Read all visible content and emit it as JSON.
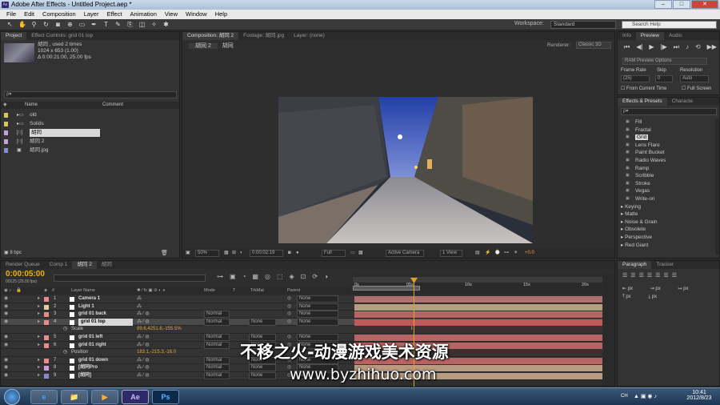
{
  "window": {
    "title": "Adobe After Effects - Untitled Project.aep *",
    "app_icon": "Ae",
    "min": "–",
    "max": "□",
    "close": "✕"
  },
  "menu": [
    "File",
    "Edit",
    "Composition",
    "Layer",
    "Effect",
    "Animation",
    "View",
    "Window",
    "Help"
  ],
  "toolbar": {
    "workspace_label": "Workspace:",
    "workspace_value": "Standard",
    "search_placeholder": "Search Help"
  },
  "project": {
    "tabs": [
      "Project",
      "Effect Controls: grid 01 top"
    ],
    "thumb_name": "胡同 , used 2 times",
    "thumb_dims": "1024 x 653 (1.00)",
    "thumb_dur": "Δ 0:00:21:00, 25.00 fps",
    "search": "ρ▾",
    "col_name": "Name",
    "col_comment": "Comment",
    "items": [
      {
        "name": "old",
        "type": "folder",
        "color": "#d9c35a"
      },
      {
        "name": "Solids",
        "type": "folder",
        "color": "#d9c35a"
      },
      {
        "name": "胡同",
        "type": "comp",
        "color": "#c7a0d8"
      },
      {
        "name": "胡同 2",
        "type": "comp",
        "color": "#c7a0d8"
      },
      {
        "name": "胡同.jpg",
        "type": "footage",
        "color": "#8a8ad0"
      }
    ],
    "bpc": "8 bpc"
  },
  "comp": {
    "tabs": [
      "Composition: 胡同 2",
      "Footage: 胡同.jpg",
      "Layer: (none)"
    ],
    "crumbs": [
      "胡同 2",
      "胡同"
    ],
    "renderer_label": "Renderer:",
    "renderer_value": "Classic 3D",
    "zoom": "50%",
    "timecode": "0:00:02:19",
    "resolution": "Full",
    "camera": "Active Camera",
    "view": "1 View",
    "exposure": "+0.0"
  },
  "info": {
    "tabs": [
      "Info",
      "Preview",
      "Audio"
    ],
    "ram_preview": "RAM Preview Options",
    "frame_rate_label": "Frame Rate",
    "skip_label": "Skip",
    "resolution_label": "Resolution",
    "frame_rate_value": "(25)",
    "skip_value": "0",
    "resolution_value": "Auto",
    "from_current": "From Current Time",
    "full_screen": "Full Screen"
  },
  "effects": {
    "tabs": [
      "Effects & Presets",
      "Characte"
    ],
    "search": "ρ▾",
    "items": [
      "Fill",
      "Fractal",
      "Grid",
      "Lens Flare",
      "Paint Bucket",
      "Radio Waves",
      "Ramp",
      "Scribble",
      "Stroke",
      "Vegas",
      "Write-on"
    ],
    "selected": "Grid",
    "categories": [
      "Keying",
      "Matte",
      "Noise & Grain",
      "Obsolete",
      "Perspective",
      "Red Giant"
    ]
  },
  "timeline": {
    "tabs": [
      "Render Queue",
      "Comp 1",
      "胡同 2",
      "胡同"
    ],
    "timecode": "0:00:05:00",
    "sub_timecode": "00125 (25.00 fps)",
    "col_layer": "Layer Name",
    "col_mode": "Mode",
    "col_t": "T",
    "col_trkmat": "TrkMat",
    "col_parent": "Parent",
    "ruler": [
      "0s",
      "05s",
      "10s",
      "15s",
      "20s"
    ],
    "layers": [
      {
        "num": "1",
        "name": "Camera 1",
        "label": "#e88a8a",
        "mode": "",
        "trk": "",
        "parent": "None",
        "bar": "#b07070"
      },
      {
        "num": "2",
        "name": "Light 1",
        "label": "#e8c9a0",
        "mode": "",
        "trk": "",
        "parent": "None",
        "bar": "#b89b80"
      },
      {
        "num": "3",
        "name": "grid 01 back",
        "label": "#e88a8a",
        "mode": "Normal",
        "trk": "",
        "parent": "None",
        "bar": "#b86464"
      },
      {
        "num": "4",
        "name": "grid 01 top",
        "label": "#e88a8a",
        "mode": "Normal",
        "trk": "None",
        "parent": "None",
        "bar": "#c05a5a",
        "selected": true
      },
      {
        "num": "",
        "name": "Scale",
        "prop": true,
        "value": "89.6,4251.8,-155.5%"
      },
      {
        "num": "5",
        "name": "grid 01 left",
        "label": "#e88a8a",
        "mode": "Normal",
        "trk": "None",
        "parent": "None",
        "bar": "#b86464"
      },
      {
        "num": "6",
        "name": "grid 01 right",
        "label": "#e88a8a",
        "mode": "Normal",
        "trk": "None",
        "parent": "None",
        "bar": "#b86464"
      },
      {
        "num": "",
        "name": "Position",
        "prop": true,
        "value": "183.1,-215.3,-16.0"
      },
      {
        "num": "7",
        "name": "grid 01 down",
        "label": "#e88a8a",
        "mode": "Normal",
        "trk": "None",
        "parent": "None",
        "bar": "#b86464"
      },
      {
        "num": "8",
        "name": "[胡同Pro",
        "label": "#c7a0d8",
        "mode": "Normal",
        "trk": "None",
        "parent": "None",
        "bar": "#b89b80"
      },
      {
        "num": "9",
        "name": "[胡同]",
        "label": "#8a8ad0",
        "mode": "Normal",
        "trk": "None",
        "parent": "None",
        "bar": "#b89b80"
      }
    ]
  },
  "paragraph": {
    "tabs": [
      "Paragraph",
      "Tracker"
    ],
    "px": [
      "px",
      "px",
      "px",
      "px",
      "px"
    ]
  },
  "watermark": {
    "line1": "不移之火-动漫游戏美术资源",
    "line2": "www.byzhihuo.com"
  },
  "taskbar": {
    "apps": [
      "e",
      "📁",
      "▶",
      "Ae",
      "Ps"
    ],
    "lang": "CH",
    "time": "10:41",
    "date": "2012/8/23"
  }
}
